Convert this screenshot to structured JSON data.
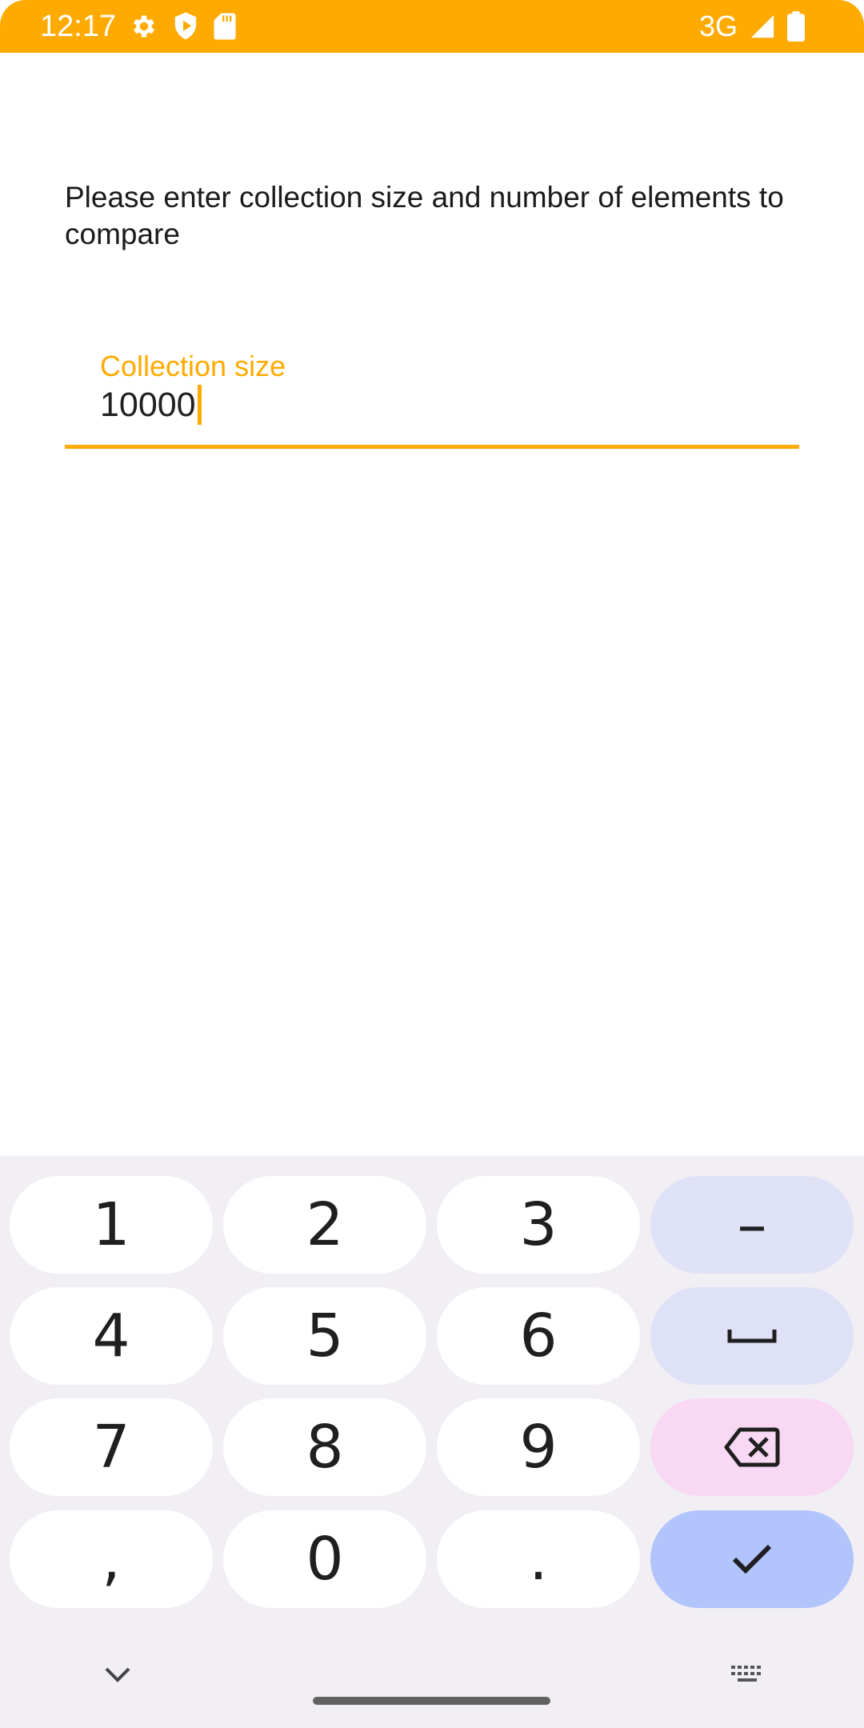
{
  "status_bar": {
    "time": "12:17",
    "network": "3G",
    "background_color": "#FFAA00",
    "icons": [
      "settings-icon",
      "shield-play-icon",
      "sd-card-icon",
      "signal-icon",
      "battery-icon"
    ]
  },
  "form": {
    "prompt": "Please enter collection size and number of elements to compare",
    "collection_size": {
      "label": "Collection size",
      "value": "10000"
    }
  },
  "keyboard": {
    "rows": [
      [
        "1",
        "2",
        "3",
        "–"
      ],
      [
        "4",
        "5",
        "6",
        "␣"
      ],
      [
        "7",
        "8",
        "9",
        "backspace"
      ],
      [
        ",",
        "0",
        ".",
        "enter"
      ]
    ],
    "keys": {
      "k1": "1",
      "k2": "2",
      "k3": "3",
      "dash": "–",
      "k4": "4",
      "k5": "5",
      "k6": "6",
      "k7": "7",
      "k8": "8",
      "k9": "9",
      "comma": ",",
      "k0": "0",
      "period": "."
    },
    "bottom": {
      "left_icon": "chevron-down-icon",
      "right_icon": "keyboard-icon"
    }
  }
}
